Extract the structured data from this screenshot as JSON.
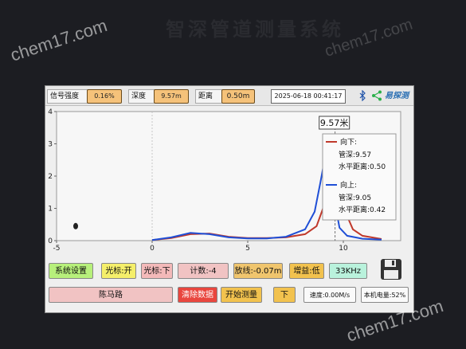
{
  "watermark": "chem17.com",
  "bezel_title": "智深管道测量系统",
  "topbar": {
    "signal_label": "信号强度",
    "signal_value": "0.16%",
    "depth_label": "深度",
    "depth_value": "9.57m",
    "distance_label": "距离",
    "distance_value": "0.50m",
    "datetime": "2025-06-18 00:41:17",
    "logo_text": "易探测"
  },
  "chart_data": {
    "type": "line",
    "title": "",
    "xlabel": "",
    "ylabel": "",
    "xlim": [
      -5,
      13
    ],
    "ylim": [
      0,
      4
    ],
    "x_ticks": [
      "-5",
      "0",
      "5",
      "10"
    ],
    "y_ticks": [
      "0",
      "1",
      "2",
      "3",
      "4"
    ],
    "grid": false,
    "series": [
      {
        "name": "向下",
        "color": "#c0392b",
        "x": [
          0,
          1,
          2,
          3,
          4,
          5,
          6,
          7,
          8,
          8.6,
          9.0,
          9.3,
          9.57,
          9.8,
          10.1,
          10.5,
          11,
          12
        ],
        "y": [
          0.02,
          0.08,
          0.2,
          0.22,
          0.12,
          0.08,
          0.08,
          0.1,
          0.2,
          0.45,
          1.1,
          2.2,
          2.95,
          2.2,
          0.9,
          0.35,
          0.15,
          0.05
        ]
      },
      {
        "name": "向上",
        "color": "#1f4fd6",
        "x": [
          0,
          1,
          2,
          3,
          4,
          5,
          6,
          7,
          8,
          8.5,
          8.8,
          9.05,
          9.3,
          9.55,
          9.8,
          10.2,
          11,
          12
        ],
        "y": [
          0.02,
          0.1,
          0.24,
          0.2,
          0.1,
          0.07,
          0.07,
          0.12,
          0.35,
          0.9,
          1.8,
          2.6,
          2.35,
          1.2,
          0.4,
          0.15,
          0.06,
          0.03
        ]
      }
    ],
    "cursor_label": "9.57米",
    "legend": {
      "down_label": "向下:",
      "down_depth": "管深:9.57",
      "down_horiz": "水平距离:0.50",
      "up_label": "向上:",
      "up_depth": "管深:9.05",
      "up_horiz": "水平距离:0.42"
    }
  },
  "buttons": {
    "system_settings": "系统设置",
    "cursor_on": "光标:开",
    "cursor_down": "光标:下",
    "count": "计数:-4",
    "baseline": "放线:-0.07m",
    "gain": "增益:低",
    "freq": "33KHz",
    "location": "陈马路",
    "clear_data": "清除数据",
    "start_measure": "开始测量",
    "direction": "下",
    "speed": "速度:0.00M/s",
    "battery": "本机电量:52%"
  }
}
